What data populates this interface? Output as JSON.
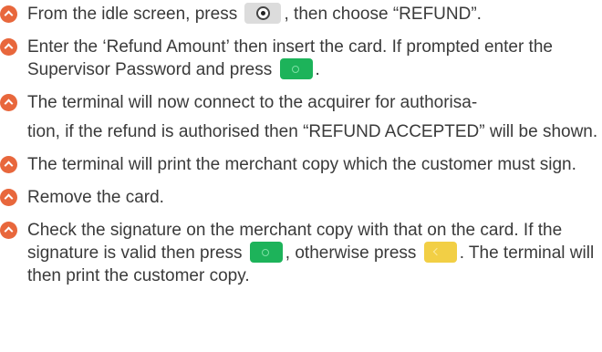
{
  "steps": [
    {
      "t1": "From the idle screen, press",
      "t2": ", then choose “REFUND”."
    },
    {
      "t1": "Enter the ‘Refund Amount’ then insert the card. If prompted enter the Supervisor Password and press",
      "t2": "."
    },
    {
      "t1": "The terminal will now connect to the acquirer for authorisa-",
      "t2": "tion, if the refund is authorised then “REFUND ACCEPTED” will be shown."
    },
    {
      "t1": "The terminal will print the merchant copy which the customer must sign."
    },
    {
      "t1": "Remove the card."
    },
    {
      "t1": "Check the signature on the merchant copy with that on the card. If the signature is valid then press",
      "t2": ", otherwise press",
      "t3": ". The terminal will then print the customer copy."
    }
  ],
  "keys": {
    "menu": "menu-key-icon",
    "ok": "green-ok-key-icon",
    "clear": "yellow-clear-key-icon"
  },
  "colors": {
    "bullet": "#e8673c",
    "ok_key": "#1db35a",
    "clear_key": "#f2cf45",
    "menu_key": "#dcdcdc",
    "text": "#3a3a3a"
  }
}
